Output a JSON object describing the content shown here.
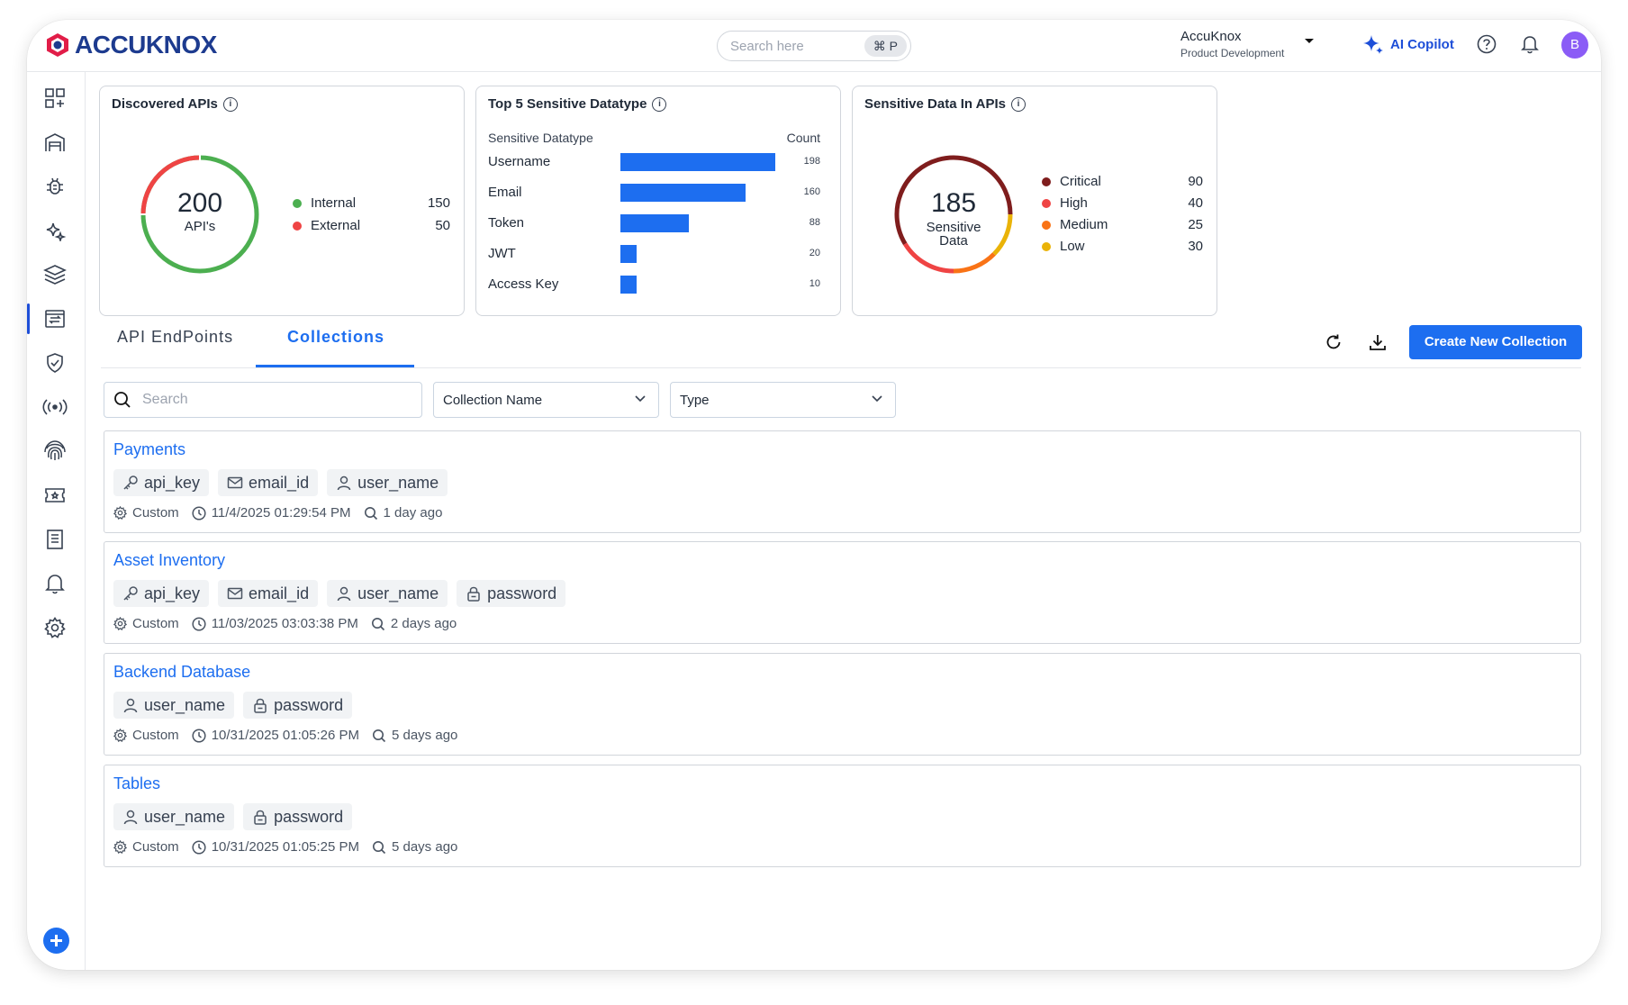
{
  "header": {
    "logo": "ACCUKNOX",
    "search_placeholder": "Search here",
    "search_shortcut": "⌘ P",
    "tenant_name": "AccuKnox",
    "tenant_sub": "Product Development",
    "copilot_label": "AI Copilot",
    "avatar_initial": "B"
  },
  "colors": {
    "primary": "#1d6ef0",
    "internal": "#4caf50",
    "external": "#ef4444",
    "critical": "#7f1d1d",
    "high": "#ef4444",
    "medium": "#f97316",
    "low": "#eab308"
  },
  "discovered": {
    "title": "Discovered APIs",
    "total": "200",
    "total_label": "API's",
    "items": [
      {
        "label": "Internal",
        "value": "150"
      },
      {
        "label": "External",
        "value": "50"
      }
    ]
  },
  "top5": {
    "title": "Top 5 Sensitive Datatype",
    "col1": "Sensitive Datatype",
    "col2": "Count",
    "rows": [
      {
        "label": "Username",
        "value": "198",
        "count": 198
      },
      {
        "label": "Email",
        "value": "160",
        "count": 160
      },
      {
        "label": "Token",
        "value": "88",
        "count": 88
      },
      {
        "label": "JWT",
        "value": "20",
        "count": 20
      },
      {
        "label": "Access Key",
        "value": "10",
        "count": 10
      }
    ]
  },
  "sensitive": {
    "title": "Sensitive Data In APIs",
    "total": "185",
    "total_label1": "Sensitive",
    "total_label2": "Data",
    "items": [
      {
        "label": "Critical",
        "value": "90"
      },
      {
        "label": "High",
        "value": "40"
      },
      {
        "label": "Medium",
        "value": "25"
      },
      {
        "label": "Low",
        "value": "30"
      }
    ]
  },
  "tabs": {
    "endpoints": "API EndPoints",
    "collections": "Collections"
  },
  "actions": {
    "create": "Create New Collection"
  },
  "filters": {
    "search_placeholder": "Search",
    "collection_name": "Collection Name",
    "type": "Type"
  },
  "collections": [
    {
      "name": "Payments",
      "tags": [
        "api_key",
        "email_id",
        "user_name"
      ],
      "kind": "Custom",
      "timestamp": "11/4/2025 01:29:54 PM",
      "ago": "1 day ago"
    },
    {
      "name": "Asset Inventory",
      "tags": [
        "api_key",
        "email_id",
        "user_name",
        "password"
      ],
      "kind": "Custom",
      "timestamp": "11/03/2025 03:03:38 PM",
      "ago": "2 days ago"
    },
    {
      "name": "Backend Database",
      "tags": [
        "user_name",
        "password"
      ],
      "kind": "Custom",
      "timestamp": "10/31/2025 01:05:26 PM",
      "ago": "5 days ago"
    },
    {
      "name": "Tables",
      "tags": [
        "user_name",
        "password"
      ],
      "kind": "Custom",
      "timestamp": "10/31/2025 01:05:25 PM",
      "ago": "5 days ago"
    }
  ]
}
